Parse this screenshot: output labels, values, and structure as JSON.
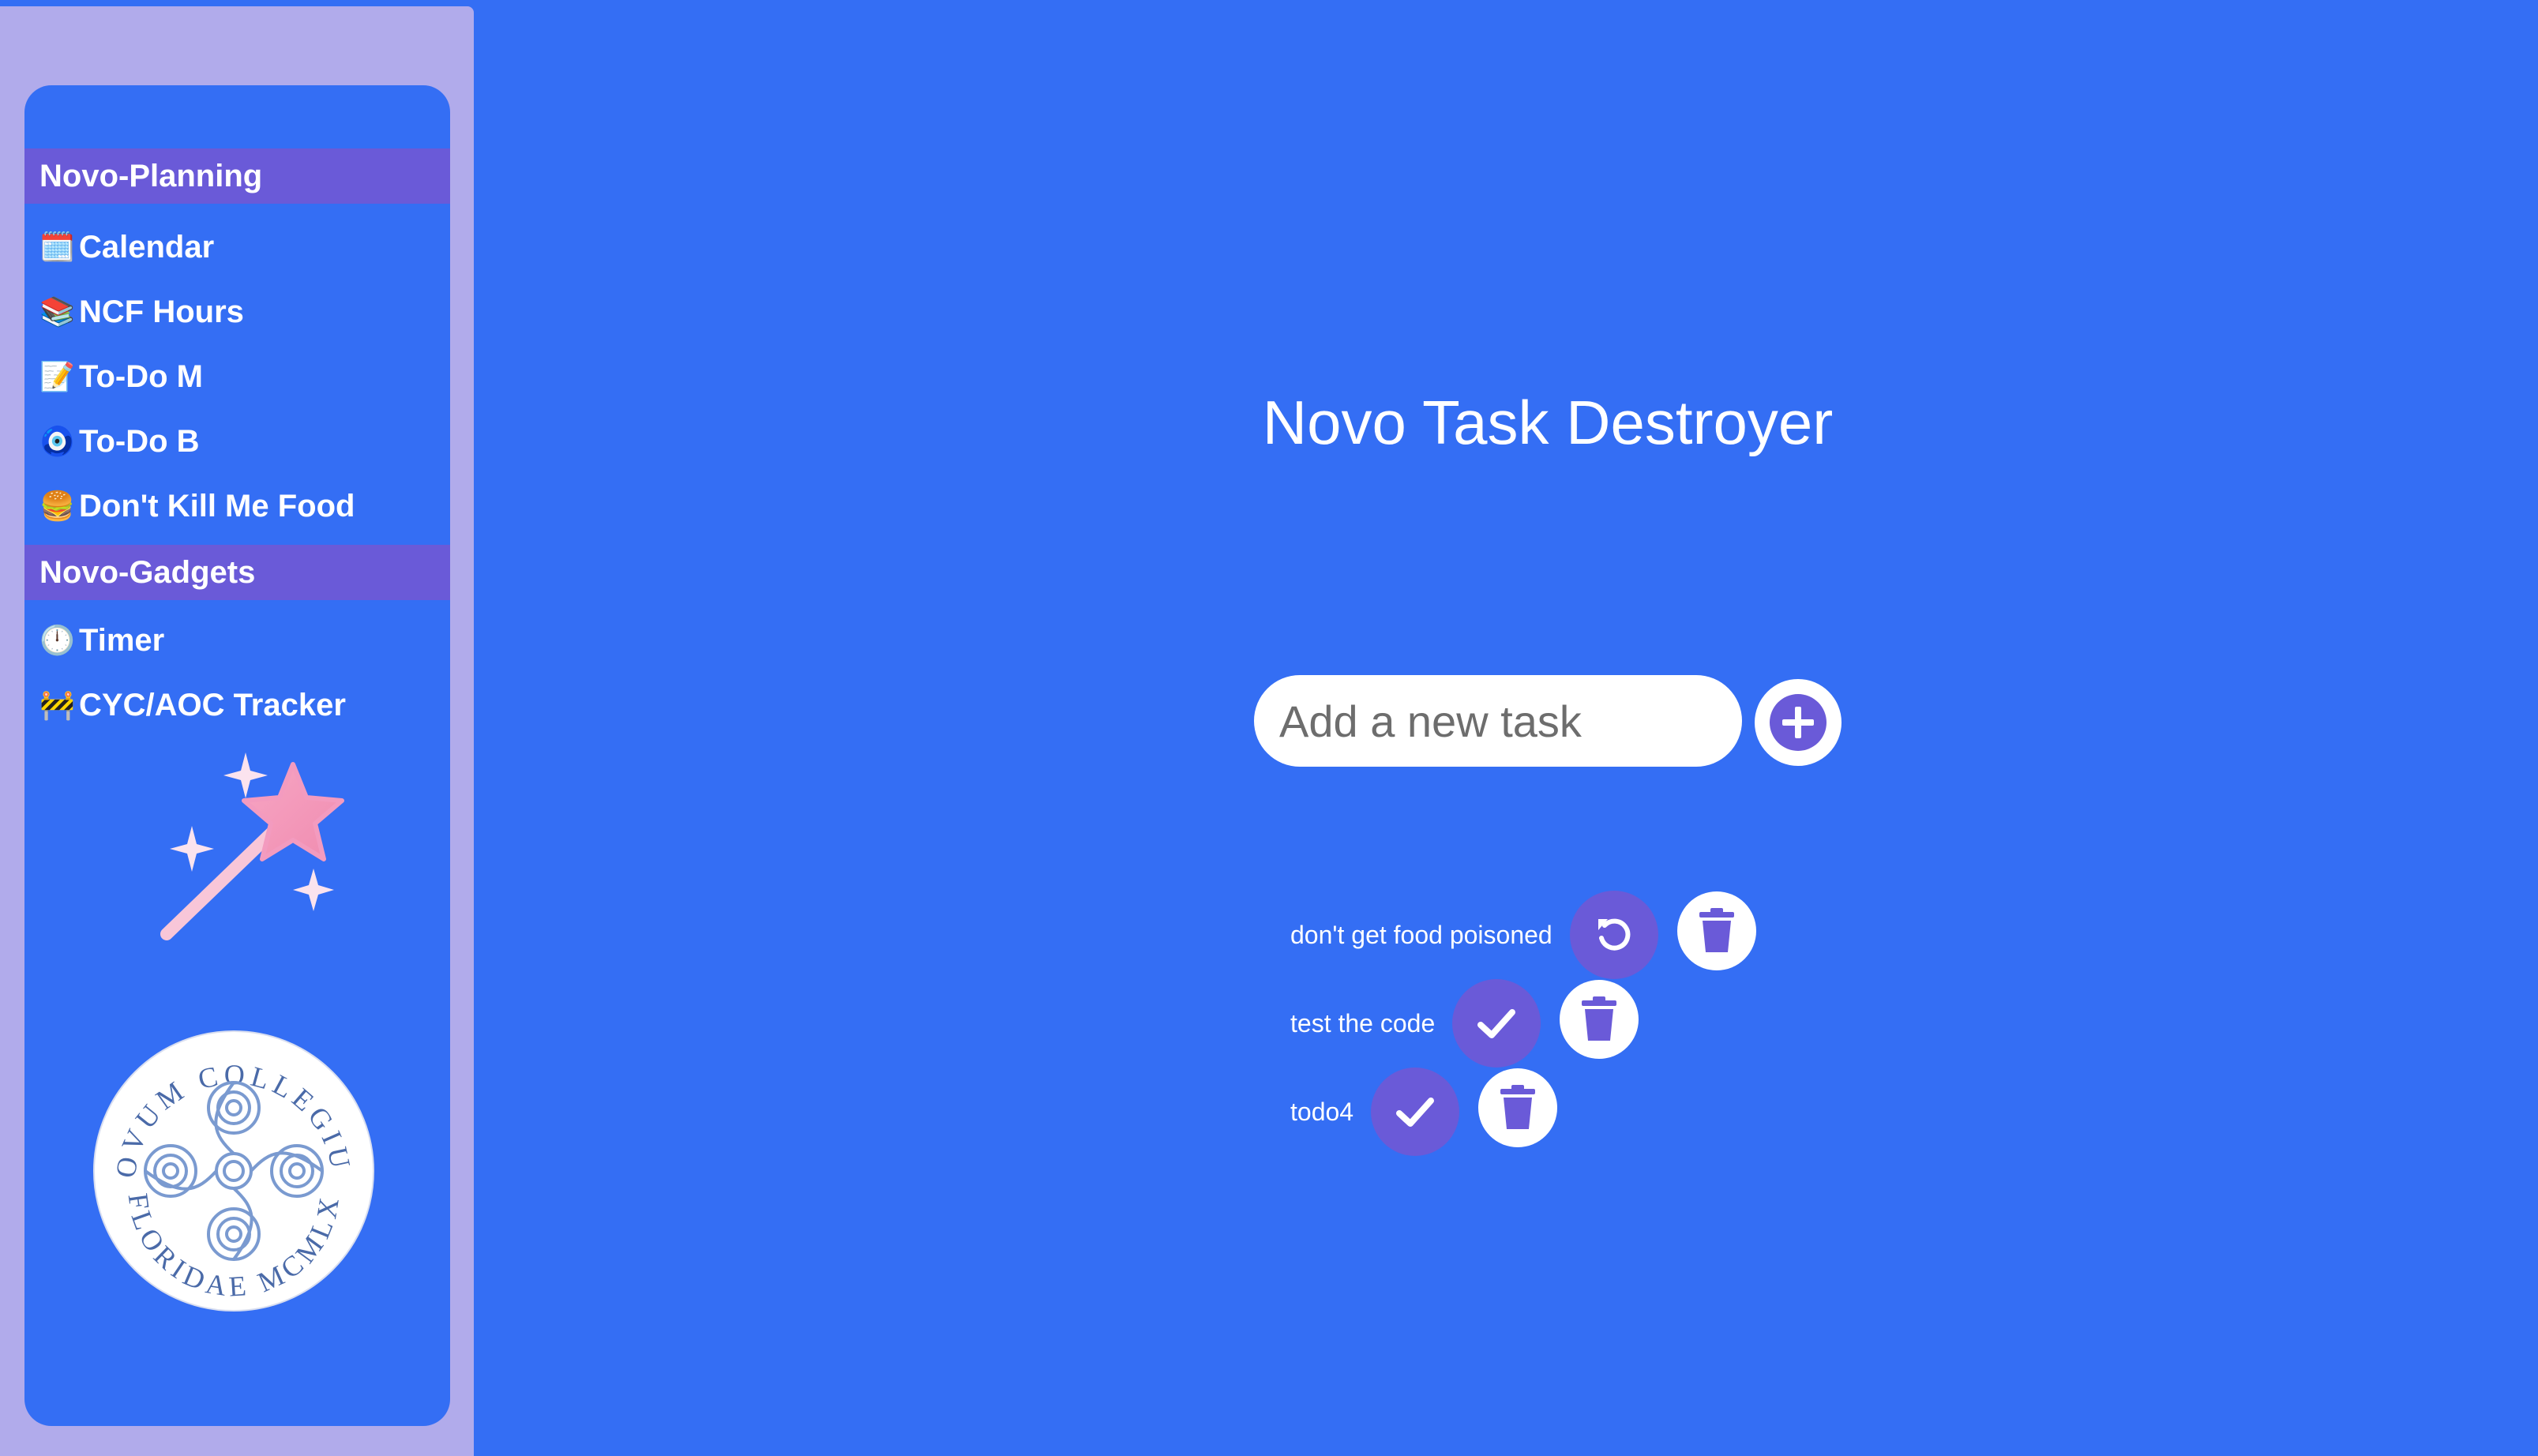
{
  "colors": {
    "background": "#346ef4",
    "sidebar_frame": "#b1abeb",
    "section_header": "#6a5ad8",
    "accent": "#6a5ad8",
    "text": "#ffffff"
  },
  "sidebar": {
    "sections": [
      {
        "title": "Novo-Planning",
        "items": [
          {
            "icon": "calendar-icon",
            "emoji": "🗓️",
            "label": "Calendar"
          },
          {
            "icon": "books-icon",
            "emoji": "📚",
            "label": "NCF Hours"
          },
          {
            "icon": "memo-icon",
            "emoji": "📝",
            "label": "To-Do M"
          },
          {
            "icon": "nazar-amulet-icon",
            "emoji": "🧿",
            "label": "To-Do B"
          },
          {
            "icon": "burger-icon",
            "emoji": "🍔",
            "label": "Don't Kill Me Food"
          }
        ]
      },
      {
        "title": "Novo-Gadgets",
        "items": [
          {
            "icon": "clock-icon",
            "emoji": "🕛",
            "label": "Timer"
          },
          {
            "icon": "construction-sign-icon",
            "emoji": "🚧",
            "label": "CYC/AOC Tracker"
          }
        ]
      }
    ],
    "logo": {
      "name": "novum-collegium-seal",
      "text_top": "NOVUM COLLEGIUM",
      "text_bottom": "FLORIDAE MCMLX"
    }
  },
  "main": {
    "title": "Novo Task Destroyer",
    "input": {
      "placeholder": "Add a new task",
      "value": ""
    },
    "add_button_icon": "plus-circle-icon",
    "todos": [
      {
        "text": "don't get food poisoned",
        "status_icon": "undo-icon",
        "completed": true
      },
      {
        "text": "test the code",
        "status_icon": "check-icon",
        "completed": false
      },
      {
        "text": "todo4",
        "status_icon": "check-icon",
        "completed": false
      }
    ],
    "delete_icon": "trash-icon"
  }
}
